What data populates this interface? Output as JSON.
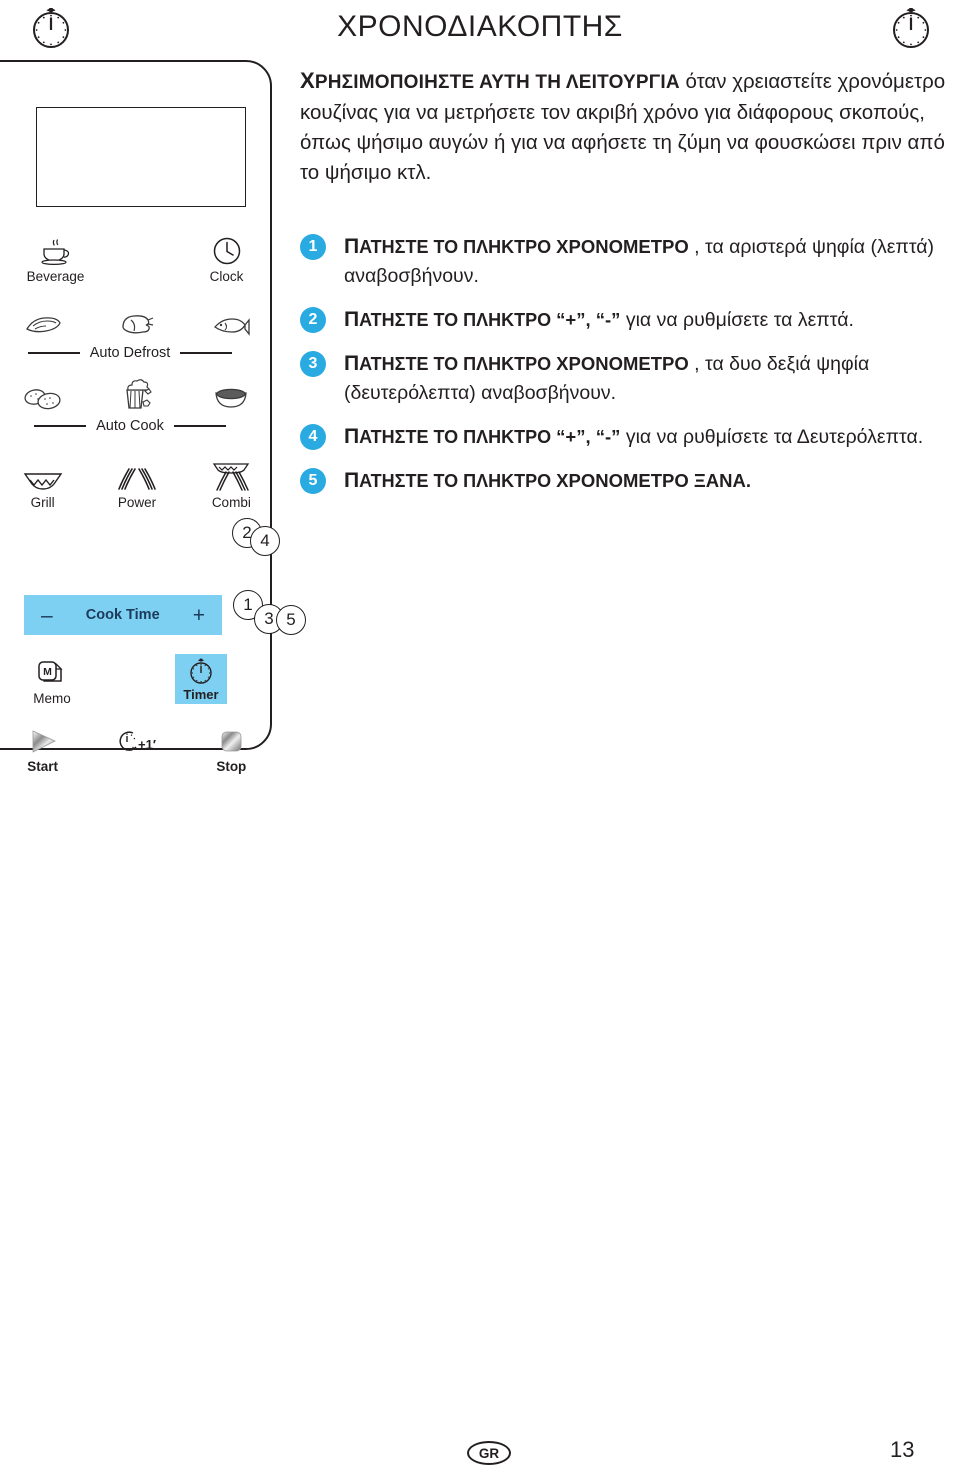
{
  "header": {
    "title": "ΧΡΟΝΟΔΙΑΚΟΠΤΗΣ",
    "icon_left": "stopwatch-icon",
    "icon_right": "stopwatch-icon"
  },
  "intro": {
    "lead_cap": "Χ",
    "lead": "ΡΗΣΙΜΟΠΟΙΗΣΤΕ ΑΥΤΗ ΤΗ ΛΕΙΤΟΥΡΓΙΑ",
    "body": " όταν χρειαστείτε χρονόμετρο κουζίνας για να μετρήσετε τον ακριβή χρόνο για διάφορους σκοπούς, όπως ψήσιμο αυγών ή για να αφήσετε τη ζύμη να φουσκώσει πριν από το ψήσιμο κτλ."
  },
  "control_panel": {
    "keys": [
      {
        "label": "Beverage",
        "icon": "coffee-cup-icon"
      },
      {
        "label": "Clock",
        "icon": "clock-icon"
      },
      {
        "label": "",
        "icon": "meat-icon"
      },
      {
        "label": "",
        "icon": "chicken-icon"
      },
      {
        "label": "",
        "icon": "fish-icon"
      },
      {
        "label": "",
        "icon": "potato-icon"
      },
      {
        "label": "",
        "icon": "popcorn-icon"
      },
      {
        "label": "",
        "icon": "soup-bowl-icon"
      },
      {
        "label": "Grill",
        "icon": "grill-icon"
      },
      {
        "label": "Power",
        "icon": "power-waves-icon"
      },
      {
        "label": "Combi",
        "icon": "combi-icon"
      },
      {
        "label": "Memo",
        "icon": "memo-icon"
      },
      {
        "label": "Timer",
        "icon": "stopwatch-icon"
      },
      {
        "label": "Start",
        "icon": "play-triangle-icon"
      },
      {
        "label": "",
        "icon": "plus-one-minute-icon"
      },
      {
        "label": "Stop",
        "icon": "stop-square-icon"
      }
    ],
    "group_labels": {
      "auto_defrost": "Auto Defrost",
      "auto_cook": "Auto Cook"
    },
    "cook_time": {
      "minus": "–",
      "label": "Cook Time",
      "plus": "+"
    },
    "plus_one_label": "+1′",
    "memo_letter": "M",
    "callouts": [
      "2",
      "4",
      "1",
      "3",
      "5"
    ],
    "colors": {
      "key_highlight": "#7ed0f2",
      "outline": "#231f20",
      "cook_time_text": "#1b3a5c"
    }
  },
  "steps": [
    {
      "num": "1",
      "bold_cap": "Π",
      "bold": "ΑΤΗΣΤΕ ΤΟ ΠΛΗΚΤΡΟ ",
      "strong": "ΧΡΟΝΟΜΕΤΡΟ",
      "rest": " , τα αριστερά ψηφία (λεπτά) αναβοσβήνουν."
    },
    {
      "num": "2",
      "bold_cap": "Π",
      "bold": "ΑΤΗΣΤΕ ΤΟ ΠΛΗΚΤΡΟ ",
      "strong": "“+”, “-”",
      "rest": " για να ρυθμίσετε τα λεπτά."
    },
    {
      "num": "3",
      "bold_cap": "Π",
      "bold": "ΑΤΗΣΤΕ ΤΟ ΠΛΗΚΤΡΟ ",
      "strong": "ΧΡΟΝΟΜΕΤΡΟ",
      "rest": " , τα δυο δεξιά ψηφία (δευτερόλεπτα) αναβοσβήνουν."
    },
    {
      "num": "4",
      "bold_cap": "Π",
      "bold": "ΑΤΗΣΤΕ ΤΟ ΠΛΗΚΤΡΟ ",
      "strong": "“+”, “-”",
      "rest": " για να ρυθμίσετε τα Δευτερόλεπτα."
    },
    {
      "num": "5",
      "bold_cap": "Π",
      "bold": "ΑΤΗΣΤΕ ΤΟ ΠΛΗΚΤΡΟ ",
      "strong": "ΧΡΟΝΟΜΕΤΡΟ ΞΑΝΑ.",
      "rest": ""
    }
  ],
  "footer": {
    "locale_badge": "GR",
    "page_number": "13"
  },
  "accent_color": "#29abe2"
}
